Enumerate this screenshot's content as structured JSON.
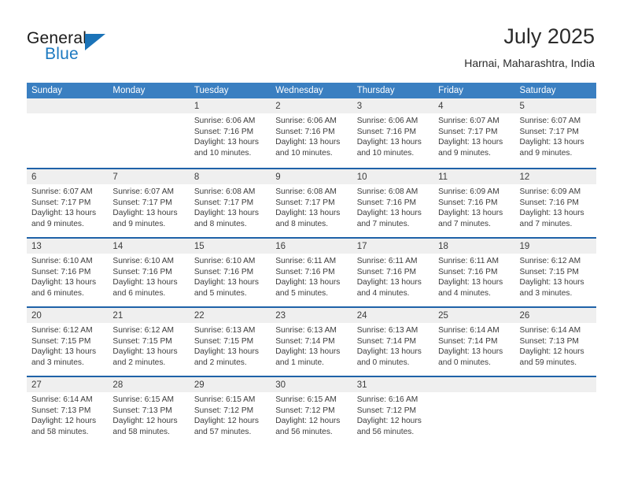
{
  "brand": {
    "name_part1": "General",
    "name_part2": "Blue"
  },
  "header": {
    "title": "July 2025",
    "subtitle": "Harnai, Maharashtra, India"
  },
  "colors": {
    "header_blue": "#3a7fc1",
    "row_separator_blue": "#1f62a8",
    "day_band_gray": "#efefef",
    "logo_blue": "#1c79c0",
    "text": "#3c3c3c"
  },
  "weekdays": [
    "Sunday",
    "Monday",
    "Tuesday",
    "Wednesday",
    "Thursday",
    "Friday",
    "Saturday"
  ],
  "weeks": [
    [
      {
        "day": "",
        "sunrise": "",
        "sunset": "",
        "daylight_line1": "",
        "daylight_line2": "",
        "empty": true
      },
      {
        "day": "",
        "sunrise": "",
        "sunset": "",
        "daylight_line1": "",
        "daylight_line2": "",
        "empty": true
      },
      {
        "day": "1",
        "sunrise": "Sunrise: 6:06 AM",
        "sunset": "Sunset: 7:16 PM",
        "daylight_line1": "Daylight: 13 hours",
        "daylight_line2": "and 10 minutes."
      },
      {
        "day": "2",
        "sunrise": "Sunrise: 6:06 AM",
        "sunset": "Sunset: 7:16 PM",
        "daylight_line1": "Daylight: 13 hours",
        "daylight_line2": "and 10 minutes."
      },
      {
        "day": "3",
        "sunrise": "Sunrise: 6:06 AM",
        "sunset": "Sunset: 7:16 PM",
        "daylight_line1": "Daylight: 13 hours",
        "daylight_line2": "and 10 minutes."
      },
      {
        "day": "4",
        "sunrise": "Sunrise: 6:07 AM",
        "sunset": "Sunset: 7:17 PM",
        "daylight_line1": "Daylight: 13 hours",
        "daylight_line2": "and 9 minutes."
      },
      {
        "day": "5",
        "sunrise": "Sunrise: 6:07 AM",
        "sunset": "Sunset: 7:17 PM",
        "daylight_line1": "Daylight: 13 hours",
        "daylight_line2": "and 9 minutes."
      }
    ],
    [
      {
        "day": "6",
        "sunrise": "Sunrise: 6:07 AM",
        "sunset": "Sunset: 7:17 PM",
        "daylight_line1": "Daylight: 13 hours",
        "daylight_line2": "and 9 minutes."
      },
      {
        "day": "7",
        "sunrise": "Sunrise: 6:07 AM",
        "sunset": "Sunset: 7:17 PM",
        "daylight_line1": "Daylight: 13 hours",
        "daylight_line2": "and 9 minutes."
      },
      {
        "day": "8",
        "sunrise": "Sunrise: 6:08 AM",
        "sunset": "Sunset: 7:17 PM",
        "daylight_line1": "Daylight: 13 hours",
        "daylight_line2": "and 8 minutes."
      },
      {
        "day": "9",
        "sunrise": "Sunrise: 6:08 AM",
        "sunset": "Sunset: 7:17 PM",
        "daylight_line1": "Daylight: 13 hours",
        "daylight_line2": "and 8 minutes."
      },
      {
        "day": "10",
        "sunrise": "Sunrise: 6:08 AM",
        "sunset": "Sunset: 7:16 PM",
        "daylight_line1": "Daylight: 13 hours",
        "daylight_line2": "and 7 minutes."
      },
      {
        "day": "11",
        "sunrise": "Sunrise: 6:09 AM",
        "sunset": "Sunset: 7:16 PM",
        "daylight_line1": "Daylight: 13 hours",
        "daylight_line2": "and 7 minutes."
      },
      {
        "day": "12",
        "sunrise": "Sunrise: 6:09 AM",
        "sunset": "Sunset: 7:16 PM",
        "daylight_line1": "Daylight: 13 hours",
        "daylight_line2": "and 7 minutes."
      }
    ],
    [
      {
        "day": "13",
        "sunrise": "Sunrise: 6:10 AM",
        "sunset": "Sunset: 7:16 PM",
        "daylight_line1": "Daylight: 13 hours",
        "daylight_line2": "and 6 minutes."
      },
      {
        "day": "14",
        "sunrise": "Sunrise: 6:10 AM",
        "sunset": "Sunset: 7:16 PM",
        "daylight_line1": "Daylight: 13 hours",
        "daylight_line2": "and 6 minutes."
      },
      {
        "day": "15",
        "sunrise": "Sunrise: 6:10 AM",
        "sunset": "Sunset: 7:16 PM",
        "daylight_line1": "Daylight: 13 hours",
        "daylight_line2": "and 5 minutes."
      },
      {
        "day": "16",
        "sunrise": "Sunrise: 6:11 AM",
        "sunset": "Sunset: 7:16 PM",
        "daylight_line1": "Daylight: 13 hours",
        "daylight_line2": "and 5 minutes."
      },
      {
        "day": "17",
        "sunrise": "Sunrise: 6:11 AM",
        "sunset": "Sunset: 7:16 PM",
        "daylight_line1": "Daylight: 13 hours",
        "daylight_line2": "and 4 minutes."
      },
      {
        "day": "18",
        "sunrise": "Sunrise: 6:11 AM",
        "sunset": "Sunset: 7:16 PM",
        "daylight_line1": "Daylight: 13 hours",
        "daylight_line2": "and 4 minutes."
      },
      {
        "day": "19",
        "sunrise": "Sunrise: 6:12 AM",
        "sunset": "Sunset: 7:15 PM",
        "daylight_line1": "Daylight: 13 hours",
        "daylight_line2": "and 3 minutes."
      }
    ],
    [
      {
        "day": "20",
        "sunrise": "Sunrise: 6:12 AM",
        "sunset": "Sunset: 7:15 PM",
        "daylight_line1": "Daylight: 13 hours",
        "daylight_line2": "and 3 minutes."
      },
      {
        "day": "21",
        "sunrise": "Sunrise: 6:12 AM",
        "sunset": "Sunset: 7:15 PM",
        "daylight_line1": "Daylight: 13 hours",
        "daylight_line2": "and 2 minutes."
      },
      {
        "day": "22",
        "sunrise": "Sunrise: 6:13 AM",
        "sunset": "Sunset: 7:15 PM",
        "daylight_line1": "Daylight: 13 hours",
        "daylight_line2": "and 2 minutes."
      },
      {
        "day": "23",
        "sunrise": "Sunrise: 6:13 AM",
        "sunset": "Sunset: 7:14 PM",
        "daylight_line1": "Daylight: 13 hours",
        "daylight_line2": "and 1 minute."
      },
      {
        "day": "24",
        "sunrise": "Sunrise: 6:13 AM",
        "sunset": "Sunset: 7:14 PM",
        "daylight_line1": "Daylight: 13 hours",
        "daylight_line2": "and 0 minutes."
      },
      {
        "day": "25",
        "sunrise": "Sunrise: 6:14 AM",
        "sunset": "Sunset: 7:14 PM",
        "daylight_line1": "Daylight: 13 hours",
        "daylight_line2": "and 0 minutes."
      },
      {
        "day": "26",
        "sunrise": "Sunrise: 6:14 AM",
        "sunset": "Sunset: 7:13 PM",
        "daylight_line1": "Daylight: 12 hours",
        "daylight_line2": "and 59 minutes."
      }
    ],
    [
      {
        "day": "27",
        "sunrise": "Sunrise: 6:14 AM",
        "sunset": "Sunset: 7:13 PM",
        "daylight_line1": "Daylight: 12 hours",
        "daylight_line2": "and 58 minutes."
      },
      {
        "day": "28",
        "sunrise": "Sunrise: 6:15 AM",
        "sunset": "Sunset: 7:13 PM",
        "daylight_line1": "Daylight: 12 hours",
        "daylight_line2": "and 58 minutes."
      },
      {
        "day": "29",
        "sunrise": "Sunrise: 6:15 AM",
        "sunset": "Sunset: 7:12 PM",
        "daylight_line1": "Daylight: 12 hours",
        "daylight_line2": "and 57 minutes."
      },
      {
        "day": "30",
        "sunrise": "Sunrise: 6:15 AM",
        "sunset": "Sunset: 7:12 PM",
        "daylight_line1": "Daylight: 12 hours",
        "daylight_line2": "and 56 minutes."
      },
      {
        "day": "31",
        "sunrise": "Sunrise: 6:16 AM",
        "sunset": "Sunset: 7:12 PM",
        "daylight_line1": "Daylight: 12 hours",
        "daylight_line2": "and 56 minutes."
      },
      {
        "day": "",
        "sunrise": "",
        "sunset": "",
        "daylight_line1": "",
        "daylight_line2": "",
        "empty": true
      },
      {
        "day": "",
        "sunrise": "",
        "sunset": "",
        "daylight_line1": "",
        "daylight_line2": "",
        "empty": true
      }
    ]
  ]
}
